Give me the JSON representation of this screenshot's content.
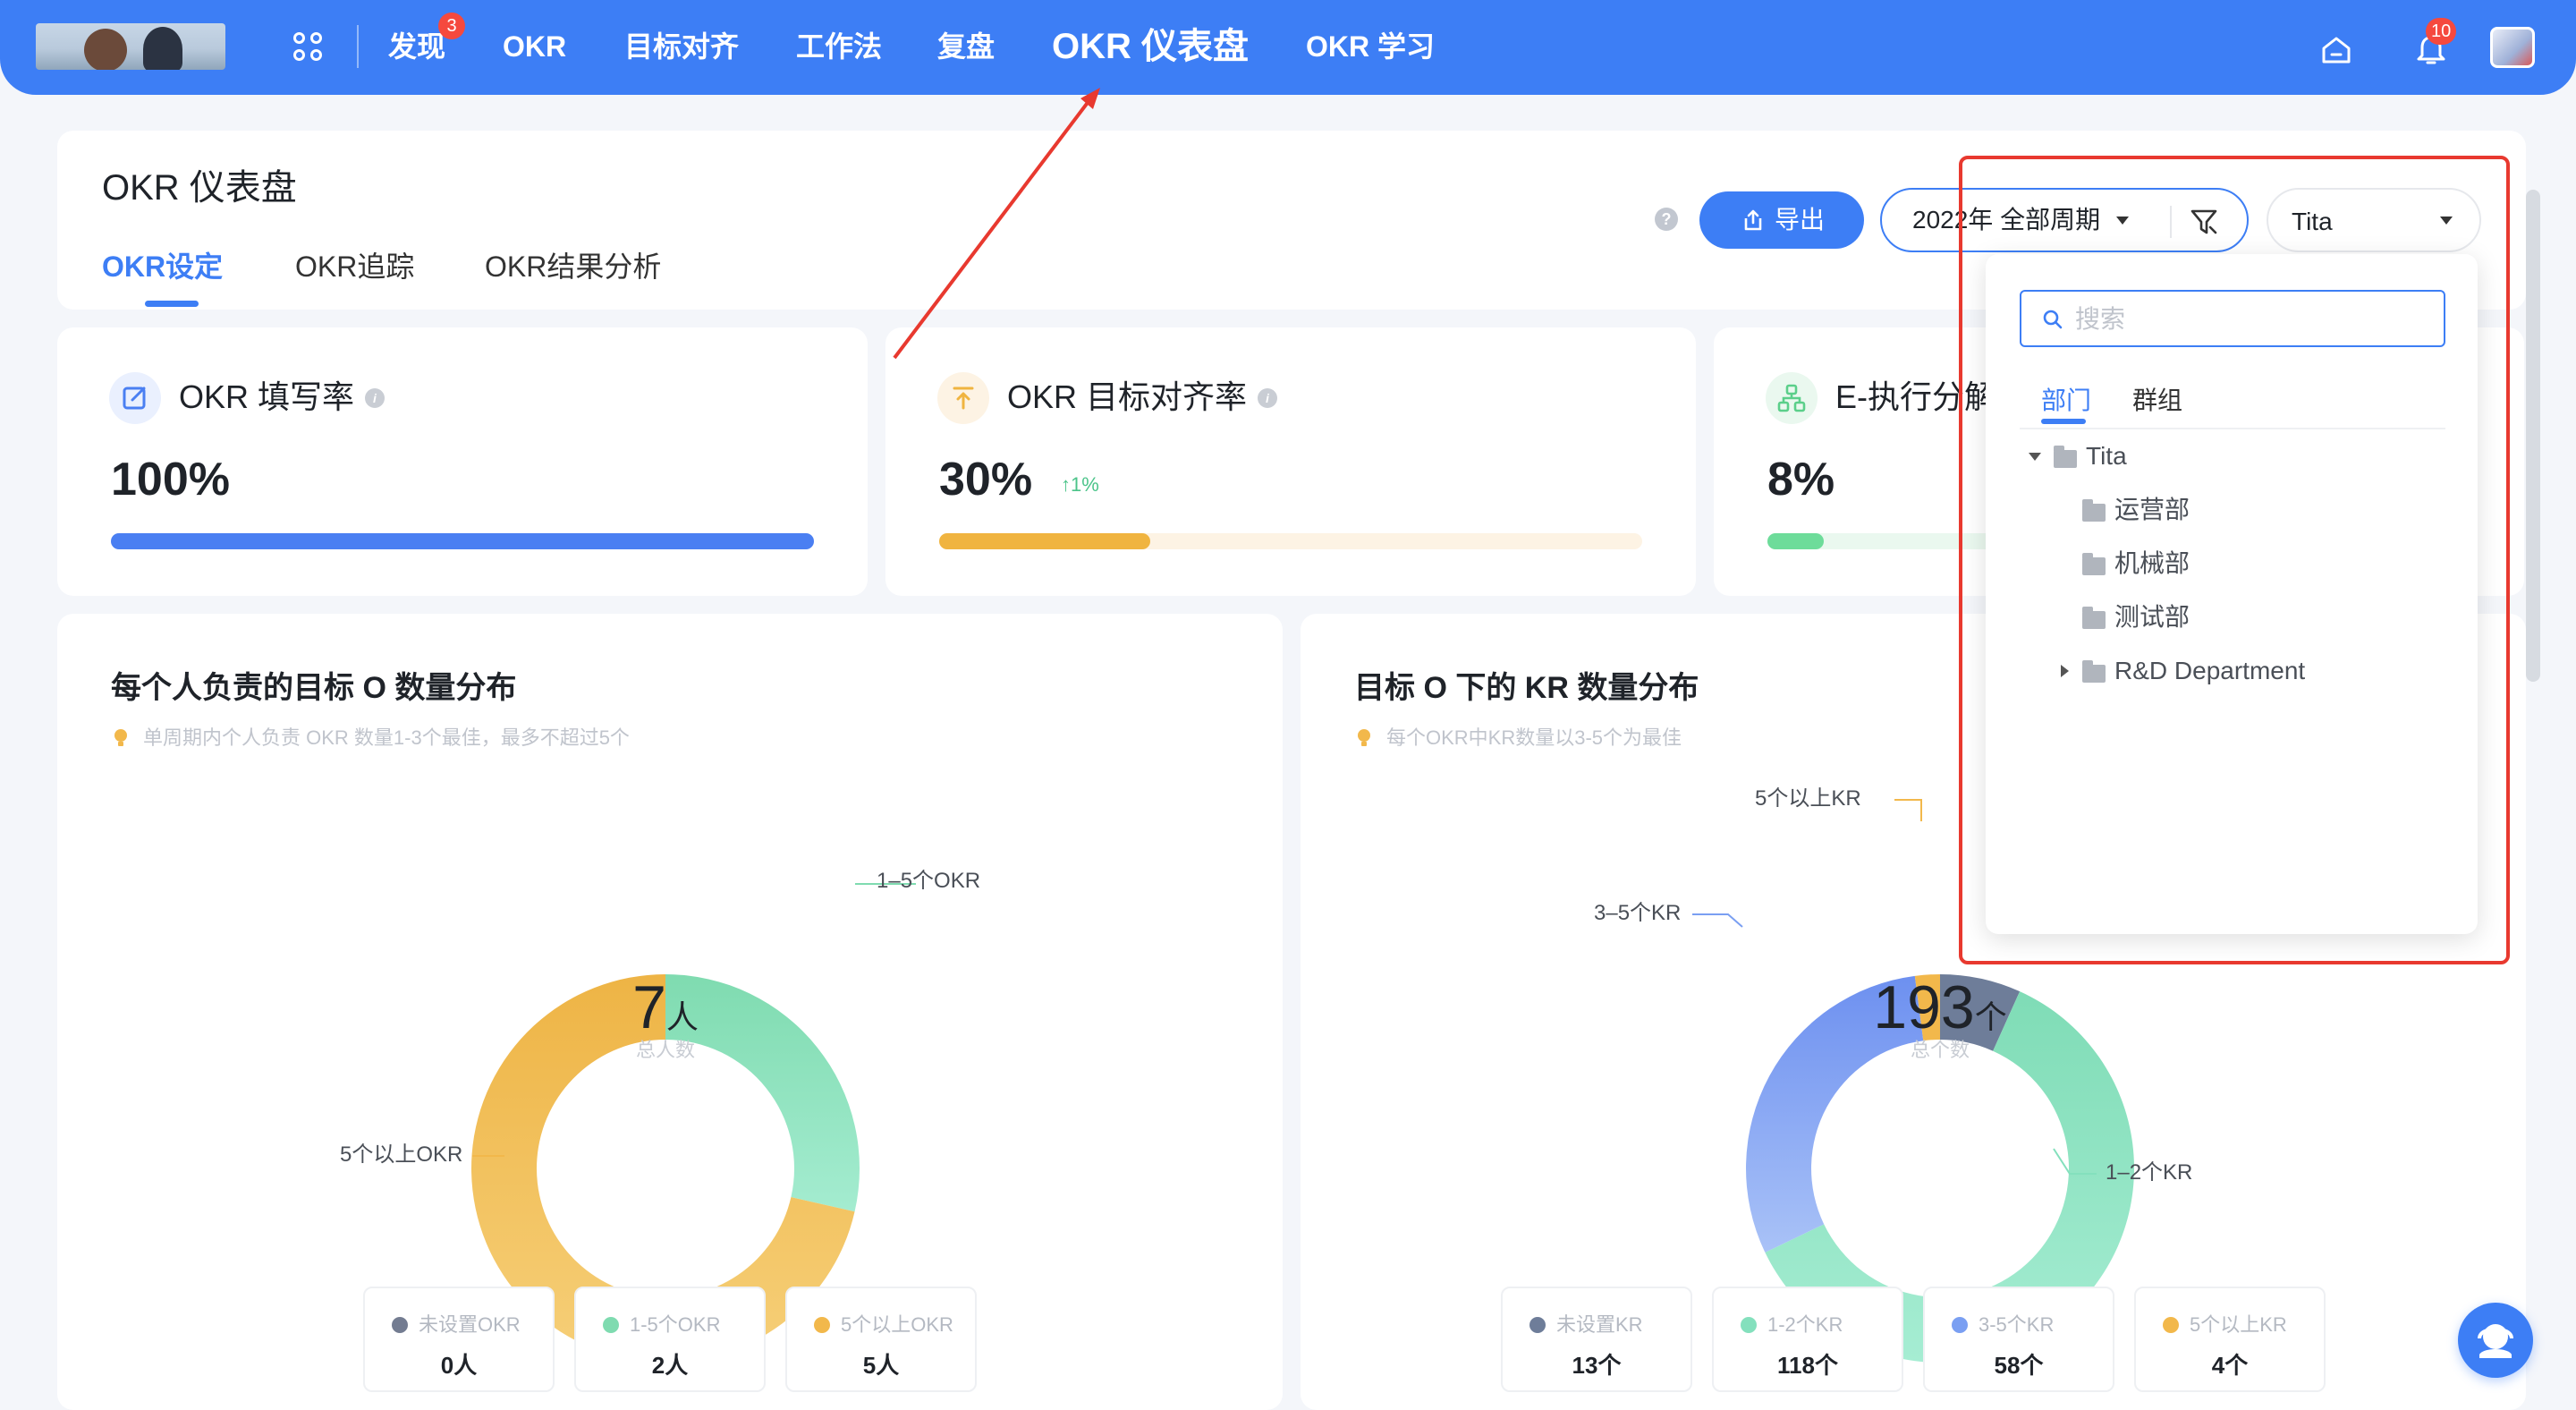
{
  "nav": {
    "items": [
      {
        "label": "发现",
        "badge": "3"
      },
      {
        "label": "OKR"
      },
      {
        "label": "目标对齐"
      },
      {
        "label": "工作法"
      },
      {
        "label": "复盘"
      },
      {
        "label": "OKR 仪表盘"
      },
      {
        "label": "OKR 学习"
      }
    ],
    "notification_badge": "10",
    "icons": [
      "app-grid-icon",
      "home-icon",
      "bell-icon",
      "avatar"
    ]
  },
  "header": {
    "title": "OKR 仪表盘",
    "tabs": [
      "OKR设定",
      "OKR追踪",
      "OKR结果分析"
    ],
    "active_tab": "OKR设定",
    "help": "?",
    "export_label": "导出",
    "period_label": "2022年 全部周期",
    "org_select": "Tita"
  },
  "metrics": [
    {
      "title": "OKR 填写率",
      "value": "100%",
      "progress": 1.0,
      "color": "#4a7ff2",
      "track": "#e8effd"
    },
    {
      "title": "OKR 目标对齐率",
      "value": "30%",
      "delta": "↑1%",
      "progress": 0.3,
      "color": "#f0b440",
      "track": "#fdf3e4"
    },
    {
      "title": "E-执行分解",
      "value": "8%",
      "progress": 0.08,
      "color": "#6ddc9a",
      "track": "#eaf8ef"
    }
  ],
  "chart_data": [
    {
      "type": "pie",
      "title": "每个人负责的目标 O 数量分布",
      "subtitle": "单周期内个人负责 OKR 数量1-3个最佳，最多不超过5个",
      "center_value": "7",
      "center_unit": "人",
      "center_label": "总人数",
      "categories": [
        "未设置OKR",
        "1-5个OKR",
        "5个以上OKR"
      ],
      "values": [
        0,
        2,
        5
      ],
      "value_labels": [
        "0人",
        "2人",
        "5人"
      ],
      "colors": [
        "#737c91",
        "#7fdbb0",
        "#f2b84b"
      ],
      "callouts": [
        "1–5个OKR",
        "5个以上OKR"
      ]
    },
    {
      "type": "pie",
      "title": "目标 O 下的 KR 数量分布",
      "subtitle": "每个OKR中KR数量以3-5个为最佳",
      "center_value": "193",
      "center_unit": "个",
      "center_label": "总个数",
      "categories": [
        "未设置KR",
        "1-2个KR",
        "3-5个KR",
        "5个以上KR"
      ],
      "values": [
        13,
        118,
        58,
        4
      ],
      "value_labels": [
        "13个",
        "118个",
        "58个",
        "4个"
      ],
      "colors": [
        "#6e7d99",
        "#84e0bd",
        "#7a9ff2",
        "#f2b84b"
      ],
      "callouts": [
        "5个以上KR",
        "3–5个KR",
        "1–2个KR"
      ]
    }
  ],
  "dropdown": {
    "search_placeholder": "搜索",
    "tabs": [
      "部门",
      "群组"
    ],
    "active_tab": "部门",
    "tree": [
      {
        "label": "Tita",
        "expanded": true
      },
      {
        "label": "运营部"
      },
      {
        "label": "机械部"
      },
      {
        "label": "测试部"
      },
      {
        "label": "R&D Department",
        "expandable": true
      }
    ]
  }
}
